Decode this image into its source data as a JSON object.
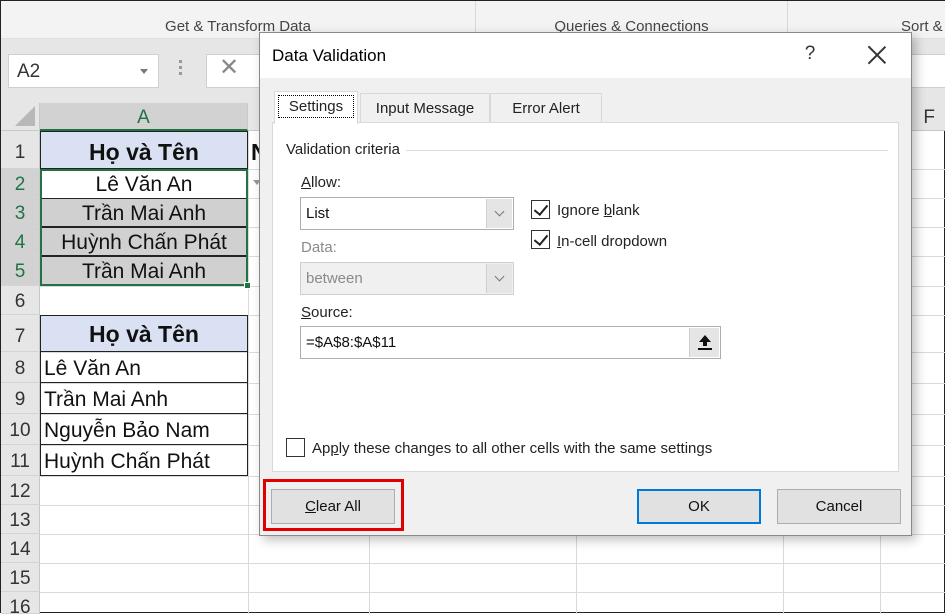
{
  "ribbon": {
    "groups": [
      "Get & Transform Data",
      "Queries & Connections",
      "Sort &"
    ]
  },
  "formula_bar": {
    "name_box": "A2",
    "cancel_glyph": "✕"
  },
  "sheet": {
    "columns": [
      "A",
      "F"
    ],
    "rows": [
      "1",
      "2",
      "3",
      "4",
      "5",
      "6",
      "7",
      "8",
      "9",
      "10",
      "11",
      "12",
      "13",
      "14",
      "15",
      "16"
    ],
    "partial_col_header_text": "N",
    "cells": {
      "A1": "Họ và Tên",
      "A2": "Lê Văn An",
      "A3": "Trần Mai Anh",
      "A4": "Huỳnh Chấn Phát",
      "A5": "Trần Mai Anh",
      "A7": "Họ và Tên",
      "A8": "Lê Văn An",
      "A9": "Trần Mai Anh",
      "A10": "Nguyễn Bảo Nam",
      "A11": "Huỳnh Chấn Phát"
    }
  },
  "dialog": {
    "title": "Data Validation",
    "help_label": "?",
    "tabs": [
      {
        "label": "Settings",
        "active": true
      },
      {
        "label": "Input Message",
        "active": false
      },
      {
        "label": "Error Alert",
        "active": false
      }
    ],
    "group_label": "Validation criteria",
    "allow": {
      "label_accel": "A",
      "label_rest": "llow:",
      "value": "List"
    },
    "data": {
      "label": "Data:",
      "value": "between",
      "disabled": true
    },
    "ignore_blank": {
      "label_pre": "Ignore ",
      "label_accel": "b",
      "label_post": "lank",
      "checked": true
    },
    "in_cell_dropdown": {
      "label_accel": "I",
      "label_rest": "n-cell dropdown",
      "checked": true
    },
    "source": {
      "label_accel": "S",
      "label_rest": "ource:",
      "value": "=$A$8:$A$11"
    },
    "apply_all": {
      "label_pre": "Ap",
      "label_accel": "p",
      "label_post": "ly these changes to all other cells with the same settings",
      "checked": false
    },
    "buttons": {
      "clear_all_accel": "C",
      "clear_all_rest": "lear All",
      "ok": "OK",
      "cancel": "Cancel"
    },
    "highlight_color": "#e00000"
  }
}
